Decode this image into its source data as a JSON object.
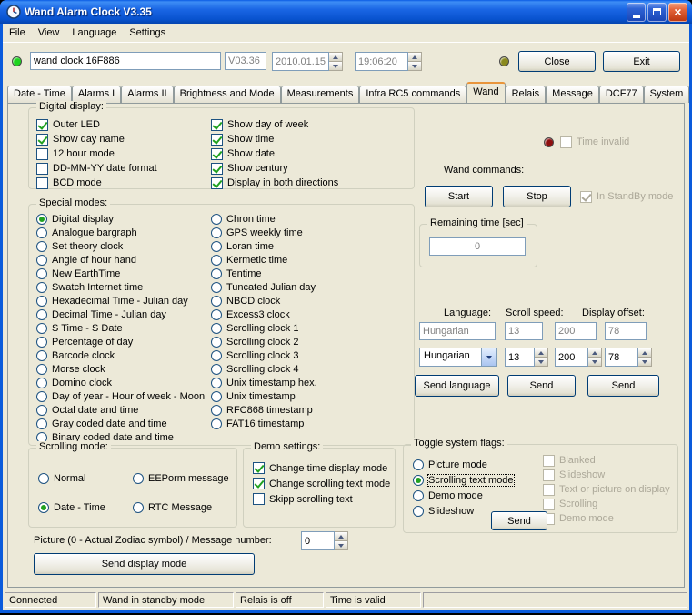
{
  "window": {
    "title": "Wand Alarm Clock V3.35"
  },
  "menu": {
    "items": [
      "File",
      "View",
      "Language",
      "Settings"
    ]
  },
  "toolbar": {
    "device_name": "wand clock 16F886",
    "version": "V03.36",
    "date": "2010.01.15.",
    "time": "19:06:20",
    "close_label": "Close",
    "exit_label": "Exit"
  },
  "tabs": {
    "items": [
      "Date - Time",
      "Alarms I",
      "Alarms II",
      "Brightness and Mode",
      "Measurements",
      "Infra RC5 commands",
      "Wand",
      "Relais",
      "Message",
      "DCF77",
      "System"
    ],
    "active": "Wand"
  },
  "digital_display": {
    "caption": "Digital display:",
    "left": [
      {
        "label": "Outer LED",
        "checked": true
      },
      {
        "label": "Show day name",
        "checked": true
      },
      {
        "label": "12 hour mode",
        "checked": false
      },
      {
        "label": "DD-MM-YY date format",
        "checked": false
      },
      {
        "label": "BCD mode",
        "checked": false
      }
    ],
    "right": [
      {
        "label": "Show day of week",
        "checked": true
      },
      {
        "label": "Show time",
        "checked": true
      },
      {
        "label": "Show date",
        "checked": true
      },
      {
        "label": "Show century",
        "checked": true
      },
      {
        "label": "Display in both directions",
        "checked": true
      }
    ]
  },
  "special_modes": {
    "caption": "Special modes:",
    "left": [
      {
        "label": "Digital display",
        "checked": true
      },
      {
        "label": "Analogue bargraph",
        "checked": false
      },
      {
        "label": "Set theory clock",
        "checked": false
      },
      {
        "label": "Angle of hour hand",
        "checked": false
      },
      {
        "label": "New EarthTime",
        "checked": false
      },
      {
        "label": "Swatch Internet time",
        "checked": false
      },
      {
        "label": "Hexadecimal Time - Julian day",
        "checked": false
      },
      {
        "label": "Decimal Time - Julian day",
        "checked": false
      },
      {
        "label": "S Time - S Date",
        "checked": false
      },
      {
        "label": "Percentage of day",
        "checked": false
      },
      {
        "label": "Barcode clock",
        "checked": false
      },
      {
        "label": "Morse clock",
        "checked": false
      },
      {
        "label": "Domino clock",
        "checked": false
      },
      {
        "label": "Day of year - Hour of week - Moon",
        "checked": false
      },
      {
        "label": "Octal date and time",
        "checked": false
      },
      {
        "label": "Gray coded date and time",
        "checked": false
      },
      {
        "label": "Binary coded date and time",
        "checked": false
      }
    ],
    "right": [
      {
        "label": "Chron time",
        "checked": false
      },
      {
        "label": "GPS weekly time",
        "checked": false
      },
      {
        "label": "Loran time",
        "checked": false
      },
      {
        "label": "Kermetic time",
        "checked": false
      },
      {
        "label": "Tentime",
        "checked": false
      },
      {
        "label": "Tuncated Julian day",
        "checked": false
      },
      {
        "label": "NBCD clock",
        "checked": false
      },
      {
        "label": "Excess3 clock",
        "checked": false
      },
      {
        "label": "Scrolling clock 1",
        "checked": false
      },
      {
        "label": "Scrolling clock 2",
        "checked": false
      },
      {
        "label": "Scrolling clock 3",
        "checked": false
      },
      {
        "label": "Scrolling clock 4",
        "checked": false
      },
      {
        "label": "Unix timestamp hex.",
        "checked": false
      },
      {
        "label": "Unix timestamp",
        "checked": false
      },
      {
        "label": "RFC868 timestamp",
        "checked": false
      },
      {
        "label": "FAT16 timestamp",
        "checked": false
      }
    ]
  },
  "right_panel": {
    "time_invalid": {
      "label": "Time invalid",
      "checked": false,
      "disabled": true
    },
    "wand_commands_label": "Wand commands:",
    "start_label": "Start",
    "stop_label": "Stop",
    "standby": {
      "label": "In StandBy mode",
      "checked": true,
      "disabled": true
    },
    "remaining": {
      "caption": "Remaining time [sec]",
      "value": "0"
    },
    "language_label": "Language:",
    "scroll_speed_label": "Scroll speed:",
    "display_offset_label": "Display offset:",
    "current": {
      "language": "Hungarian",
      "scroll_speed": "13",
      "offset1": "200",
      "offset2": "78"
    },
    "selects": {
      "language": "Hungarian",
      "scroll_speed": "13",
      "offset1": "200",
      "offset2": "78"
    },
    "send_language_label": "Send language",
    "send_speed_label": "Send",
    "send_offset_label": "Send"
  },
  "scrolling_mode": {
    "caption": "Scrolling mode:",
    "items": [
      {
        "label": "Normal",
        "checked": false
      },
      {
        "label": "EEPorm message",
        "checked": false
      },
      {
        "label": "Date - Time",
        "checked": true
      },
      {
        "label": "RTC Message",
        "checked": false
      }
    ]
  },
  "demo_settings": {
    "caption": "Demo settings:",
    "items": [
      {
        "label": "Change time display mode",
        "checked": true
      },
      {
        "label": "Change scrolling text mode",
        "checked": true
      },
      {
        "label": "Skipp scrolling text",
        "checked": false
      }
    ]
  },
  "toggle_flags": {
    "caption": "Toggle system flags:",
    "radios": [
      {
        "label": "Picture mode",
        "checked": false
      },
      {
        "label": "Scrolling text mode",
        "checked": true,
        "focused": true
      },
      {
        "label": "Demo mode",
        "checked": false
      },
      {
        "label": "Slideshow",
        "checked": false
      }
    ],
    "checks": [
      {
        "label": "Blanked",
        "checked": false,
        "disabled": true
      },
      {
        "label": "Slideshow",
        "checked": false,
        "disabled": true
      },
      {
        "label": "Text or picture on display",
        "checked": false,
        "disabled": true
      },
      {
        "label": "Scrolling",
        "checked": false,
        "disabled": true
      },
      {
        "label": "Demo mode",
        "checked": false,
        "disabled": true
      }
    ],
    "send_label": "Send"
  },
  "picture_row": {
    "label": "Picture (0 - Actual Zodiac symbol)  /  Message number:",
    "value": "0"
  },
  "send_display_mode_label": "Send display mode",
  "statusbar": {
    "panels": [
      "Connected",
      "Wand in standby mode",
      "Relais is off",
      "Time is valid"
    ]
  },
  "colors": {
    "led_green": "#1FD41F",
    "led_olive": "#8A8A1E",
    "led_red": "#8F1010",
    "check_green": "#21A121"
  }
}
